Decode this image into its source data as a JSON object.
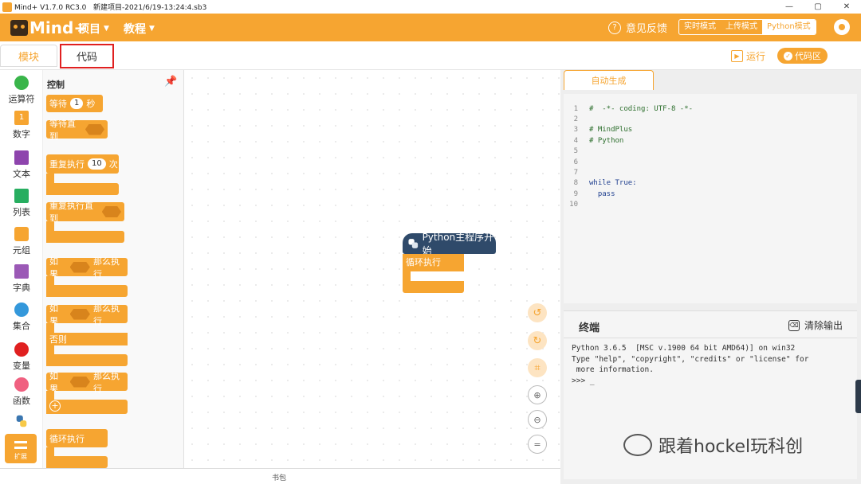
{
  "window": {
    "title": "Mind+ V1.7.0 RC3.0   新建项目-2021/6/19-13:24:4.sb3",
    "minimize": "—",
    "maximize": "▢",
    "close": "✕"
  },
  "header": {
    "logo_text": "Mind+",
    "menus": [
      "项目",
      "教程"
    ],
    "feedback_label": "意见反馈",
    "modes": [
      "实时模式",
      "上传模式",
      "Python模式"
    ],
    "active_mode": "Python模式"
  },
  "tabs": {
    "blocks_label": "模块",
    "code_label": "代码",
    "run_label": "运行",
    "code_area_label": "代码区"
  },
  "categories": [
    {
      "label": "运算符",
      "color": "#39b54a"
    },
    {
      "label": "数字",
      "color": "#f6a531"
    },
    {
      "label": "文本",
      "color": "#8e44ad"
    },
    {
      "label": "列表",
      "color": "#27ae60"
    },
    {
      "label": "元组",
      "color": "#f6a531"
    },
    {
      "label": "字典",
      "color": "#9b59b6"
    },
    {
      "label": "集合",
      "color": "#3498db"
    },
    {
      "label": "变量",
      "color": "#e02020"
    },
    {
      "label": "函数",
      "color": "#f06080"
    }
  ],
  "extension_label": "扩展",
  "palette": {
    "title": "控制",
    "wait_label": "等待",
    "wait_value": "1",
    "wait_unit": "秒",
    "wait_until_label": "等待直到",
    "repeat_label": "重复执行",
    "repeat_value": "10",
    "repeat_unit": "次",
    "repeat_until_label": "重复执行直到",
    "if_label": "如果",
    "then_label": "那么执行",
    "else_label": "否则",
    "loop_label": "循环执行"
  },
  "canvas": {
    "hat_label": "Python主程序开始",
    "loop_label": "循环执行"
  },
  "editor": {
    "tab_label": "自动生成",
    "lines": [
      {
        "n": "1",
        "text": "#  -*- coding: UTF-8 -*-"
      },
      {
        "n": "2",
        "text": ""
      },
      {
        "n": "3",
        "text": "# MindPlus"
      },
      {
        "n": "4",
        "text": "# Python"
      },
      {
        "n": "5",
        "text": ""
      },
      {
        "n": "6",
        "text": ""
      },
      {
        "n": "7",
        "text": ""
      },
      {
        "n": "8",
        "text": "while True:"
      },
      {
        "n": "9",
        "text": "  pass"
      },
      {
        "n": "10",
        "text": ""
      }
    ]
  },
  "terminal": {
    "title": "终端",
    "clear_label": "清除输出",
    "output": "Python 3.6.5  [MSC v.1900 64 bit AMD64)] on win32\nType \"help\", \"copyright\", \"credits\" or \"license\" for\n more information.\n>>> _"
  },
  "bottom": {
    "bookmark_label": "书包"
  },
  "watermark": {
    "text": "跟着hockel玩科创"
  }
}
